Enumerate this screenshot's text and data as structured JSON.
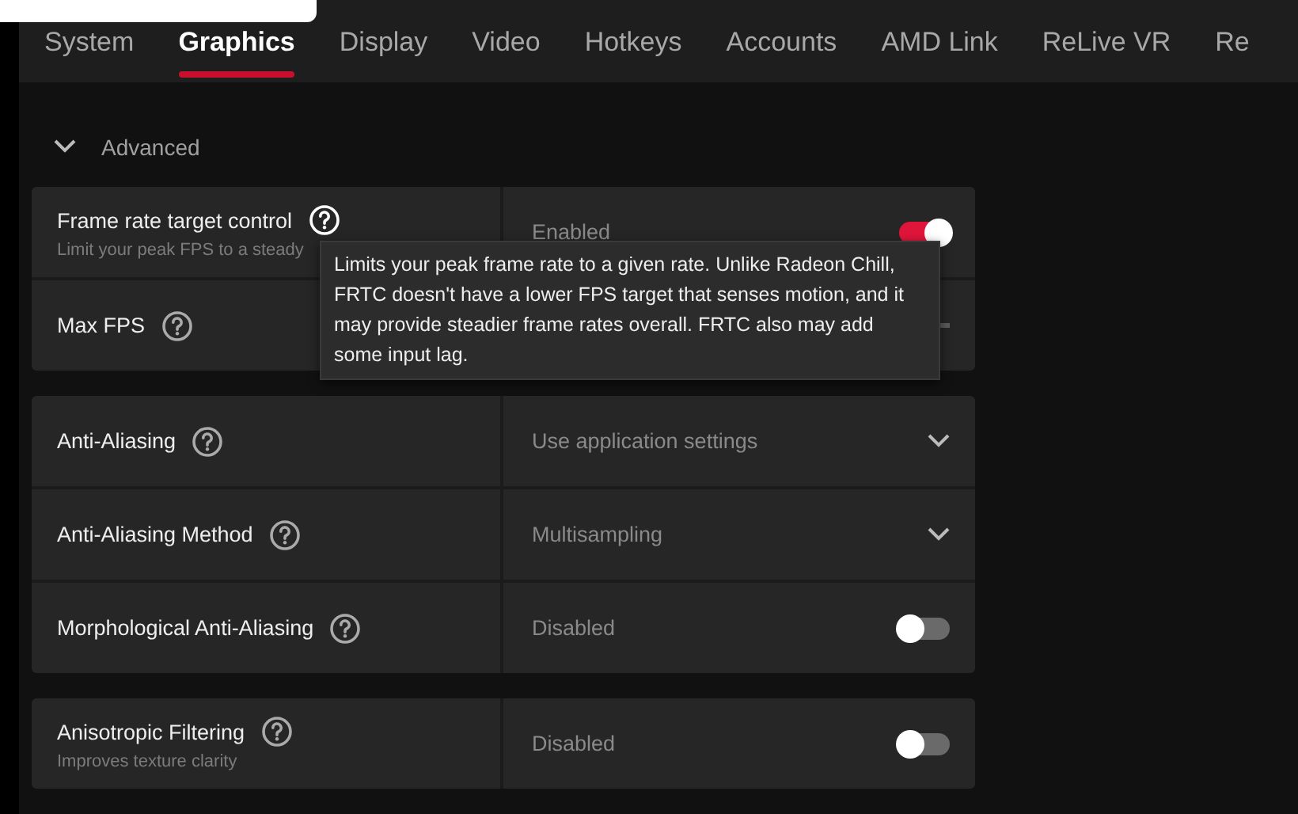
{
  "tabs": [
    {
      "label": "System",
      "selected": false
    },
    {
      "label": "Graphics",
      "selected": true
    },
    {
      "label": "Display",
      "selected": false
    },
    {
      "label": "Video",
      "selected": false
    },
    {
      "label": "Hotkeys",
      "selected": false
    },
    {
      "label": "Accounts",
      "selected": false
    },
    {
      "label": "AMD Link",
      "selected": false
    },
    {
      "label": "ReLive VR",
      "selected": false
    },
    {
      "label": "Re",
      "selected": false
    }
  ],
  "section": {
    "label": "Advanced",
    "expanded": true
  },
  "groups": [
    {
      "rows": [
        {
          "kind": "toggle",
          "label": "Frame rate target control",
          "subtitle": "Limit your peak FPS to a steady",
          "value": "Enabled",
          "on": true,
          "help_active": true
        },
        {
          "kind": "slider",
          "label": "Max FPS"
        }
      ],
      "tooltip": "Limits your peak frame rate to a given rate. Unlike Radeon Chill, FRTC doesn't have a lower FPS target that senses motion, and it may provide steadier frame rates overall. FRTC also may add some input lag."
    },
    {
      "rows": [
        {
          "kind": "dropdown",
          "label": "Anti-Aliasing",
          "value": "Use application settings"
        },
        {
          "kind": "dropdown",
          "label": "Anti-Aliasing Method",
          "value": "Multisampling"
        },
        {
          "kind": "toggle",
          "label": "Morphological Anti-Aliasing",
          "value": "Disabled",
          "on": false
        }
      ]
    },
    {
      "rows": [
        {
          "kind": "toggle",
          "label": "Anisotropic Filtering",
          "subtitle": "Improves texture clarity",
          "value": "Disabled",
          "on": false
        }
      ]
    }
  ]
}
